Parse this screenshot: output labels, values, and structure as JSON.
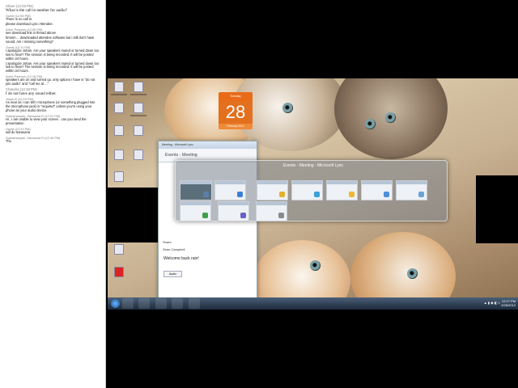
{
  "chat": {
    "messages": [
      {
        "name": "Share (12:03 PM)",
        "text": "What is the call in number for audio?",
        "big": true
      },
      {
        "name": "Guest (12:06 PM)",
        "text": "There is no call in.",
        "big": false
      },
      {
        "name": "",
        "text": "please download Lync Attendee.",
        "big": false
      },
      {
        "name": "Arbor Pearson (12:06 PM)",
        "text": "see download link in thread above",
        "big": false
      },
      {
        "name": "",
        "text": "hmmm… downloaded attendee software but i still don't have sound. Am I missing something?",
        "big": false
      },
      {
        "name": "Guest (12:11 PM)",
        "text": "I apologize Johan. Are your speakers muted or turned down too low to hear? The session is being recorded. It will be posted within 24 hours.",
        "big": false
      },
      {
        "name": "",
        "text": "I apologize Johan. Are your speakers muted or turned down too low to hear? The session is being recorded. It will be posted within 24 hours.",
        "big": false
      },
      {
        "name": "Arbor Pearson (12:16 PM)",
        "text": "speakers are on and turned up. only options I have is \"do not join audio\" and \"call me at ...\"",
        "big": false
      },
      {
        "name": "Chandra (12:18 PM)",
        "text": "I do not have any sound either.",
        "big": true
      },
      {
        "name": "Jesse B (12:19 PM)",
        "text": "As near as I can tell I microphone (or something plugged into the microphone jack) is \"required\" unless you're using your phone as your audio device.",
        "big": false
      },
      {
        "name": "Subramanyan, Saravana R (12:21 PM)",
        "text": "Hi , I am unable to view your screen . can you send the presentation",
        "big": false
      },
      {
        "name": "Guest (12:23 PM)",
        "text": "will do Saravana",
        "big": false
      },
      {
        "name": "Subramanyan, Saravana R (12:43 PM)",
        "text": "Thx",
        "big": false
      }
    ]
  },
  "calendar": {
    "weekday": "Tuesday",
    "day": "28",
    "month_year": "February 2012"
  },
  "events_window": {
    "title": "Meeting - Microsoft Lync",
    "header": "Events - Meeting",
    "rows": [
      "Share",
      "Sean Campbell"
    ],
    "welcome": "Welcome back rain!",
    "audio_button": "Audio"
  },
  "switcher": {
    "title": "Events - Meeting - Microsoft Lync",
    "thumbs": [
      {
        "name": "desktop-thumb",
        "badge": "#5a7fa8"
      },
      {
        "name": "window-thumb-2",
        "badge": "#3a7fd6"
      },
      {
        "name": "window-thumb-3",
        "badge": "#e4b12a"
      },
      {
        "name": "window-thumb-4",
        "badge": "#3aa0d8"
      },
      {
        "name": "window-thumb-5",
        "badge": "#f0b830"
      },
      {
        "name": "window-thumb-6",
        "badge": "#4f8fd8"
      },
      {
        "name": "window-thumb-7",
        "badge": "#6aa2d8"
      },
      {
        "name": "window-thumb-8",
        "badge": "#3fa04a"
      },
      {
        "name": "window-thumb-9",
        "badge": "#6b5fc8"
      },
      {
        "name": "window-thumb-10",
        "badge": "#8a8a8a"
      }
    ]
  },
  "taskbar": {
    "time": "12:27 PM",
    "date": "2/28/2012"
  }
}
